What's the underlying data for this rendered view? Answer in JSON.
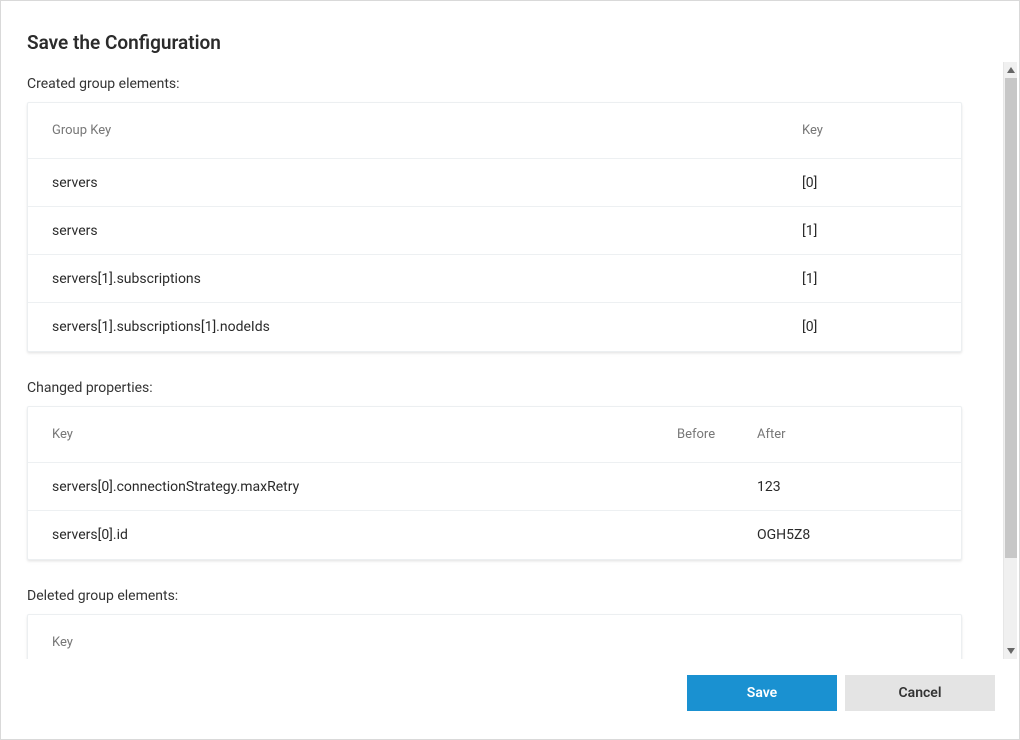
{
  "dialog": {
    "title": "Save the Configuration"
  },
  "sections": {
    "created": {
      "label": "Created group elements:",
      "columns": {
        "group_key": "Group Key",
        "key": "Key"
      },
      "rows": [
        {
          "group_key": "servers",
          "key": "[0]"
        },
        {
          "group_key": "servers",
          "key": "[1]"
        },
        {
          "group_key": "servers[1].subscriptions",
          "key": "[1]"
        },
        {
          "group_key": "servers[1].subscriptions[1].nodeIds",
          "key": "[0]"
        }
      ]
    },
    "changed": {
      "label": "Changed properties:",
      "columns": {
        "key": "Key",
        "before": "Before",
        "after": "After"
      },
      "rows": [
        {
          "key": "servers[0].connectionStrategy.maxRetry",
          "before": "",
          "after": "123"
        },
        {
          "key": "servers[0].id",
          "before": "",
          "after": "OGH5Z8"
        }
      ]
    },
    "deleted": {
      "label": "Deleted group elements:",
      "columns": {
        "key": "Key"
      },
      "rows": []
    }
  },
  "buttons": {
    "save": "Save",
    "cancel": "Cancel"
  }
}
